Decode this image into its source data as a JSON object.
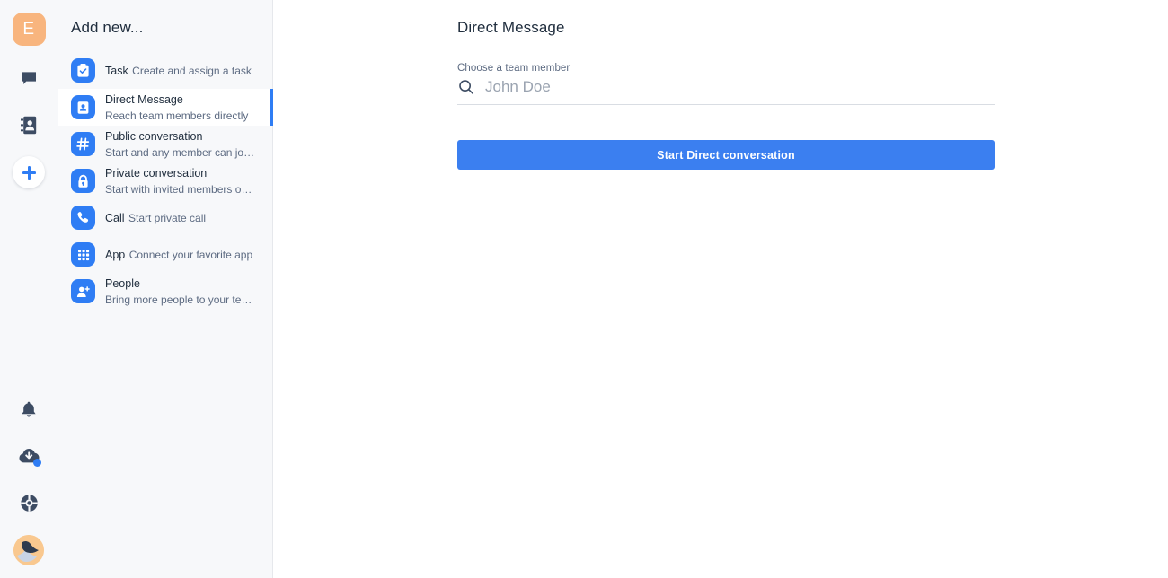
{
  "rail": {
    "workspace_initial": "E",
    "icons": [
      {
        "name": "chat-icon",
        "label": "Chat"
      },
      {
        "name": "contacts-icon",
        "label": "Contacts"
      },
      {
        "name": "add-icon",
        "label": "Add new"
      },
      {
        "name": "bell-icon",
        "label": "Notifications"
      },
      {
        "name": "cloud-download-icon",
        "label": "Downloads"
      },
      {
        "name": "lifebuoy-icon",
        "label": "Help"
      },
      {
        "name": "user-avatar",
        "label": "Profile"
      }
    ]
  },
  "panel": {
    "title": "Add new...",
    "items": [
      {
        "title": "Task",
        "subtitle": "Create and assign a task",
        "icon": "clipboard-check-icon",
        "selected": false
      },
      {
        "title": "Direct Message",
        "subtitle": "Reach team members directly",
        "icon": "contact-card-icon",
        "selected": true
      },
      {
        "title": "Public conversation",
        "subtitle": "Start and any member can jo…",
        "icon": "hash-icon",
        "selected": false
      },
      {
        "title": "Private conversation",
        "subtitle": "Start with invited members o…",
        "icon": "lock-icon",
        "selected": false
      },
      {
        "title": "Call",
        "subtitle": "Start private call",
        "icon": "phone-icon",
        "selected": false
      },
      {
        "title": "App",
        "subtitle": "Connect your favorite app",
        "icon": "grid-icon",
        "selected": false
      },
      {
        "title": "People",
        "subtitle": "Bring more people to your te…",
        "icon": "person-add-icon",
        "selected": false
      }
    ]
  },
  "main": {
    "title": "Direct Message",
    "field_label": "Choose a team member",
    "search_placeholder": "John Doe",
    "search_value": "",
    "submit_label": "Start Direct conversation"
  },
  "colors": {
    "accent": "#2f7df4",
    "button": "#3b7ff0",
    "panel_bg": "#f7f8fa",
    "avatar_top_bg": "#f8b57e"
  }
}
